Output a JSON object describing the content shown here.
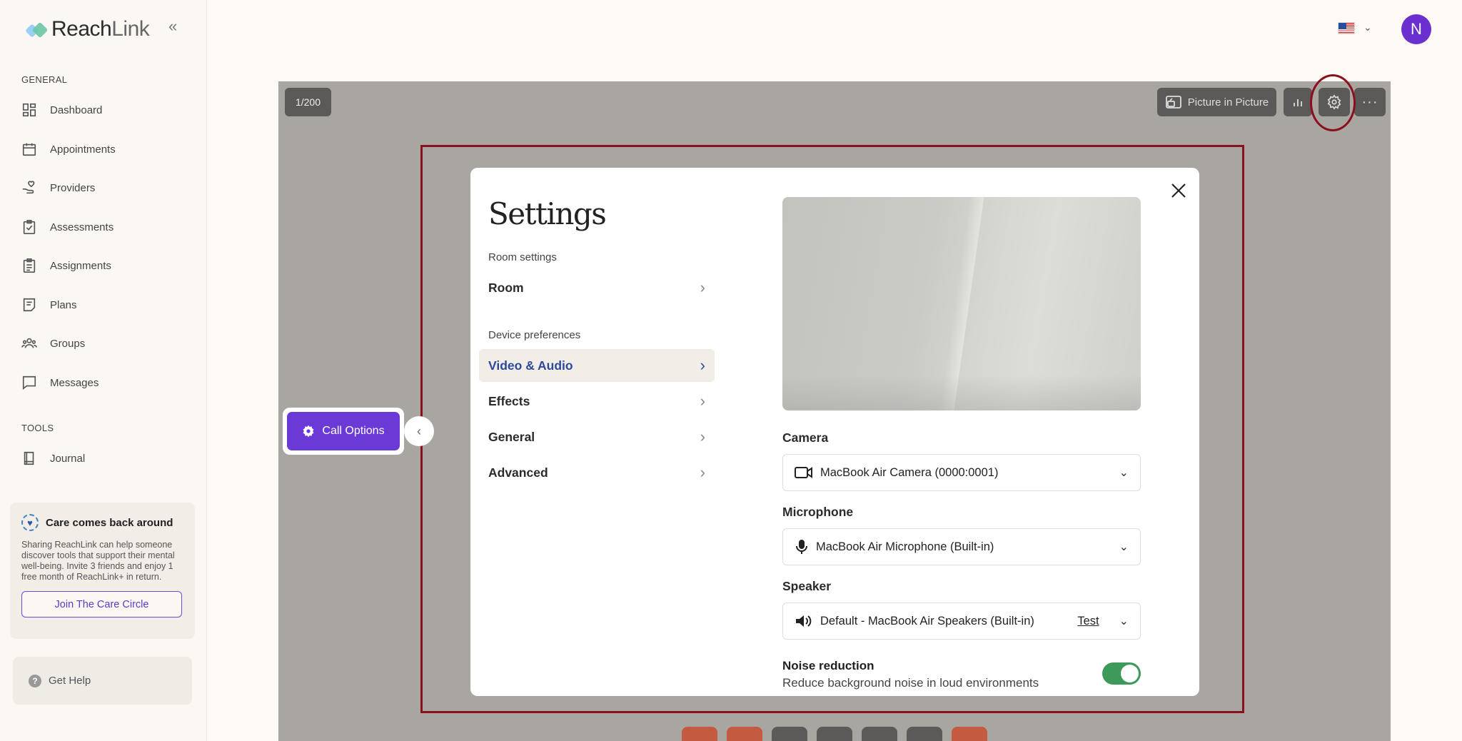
{
  "brand": {
    "name_main": "Reach",
    "name_thin": "Link"
  },
  "sidebar": {
    "general_label": "GENERAL",
    "items": [
      {
        "label": "Dashboard",
        "icon": "dashboard-icon"
      },
      {
        "label": "Appointments",
        "icon": "calendar-icon"
      },
      {
        "label": "Providers",
        "icon": "provider-hand-icon"
      },
      {
        "label": "Assessments",
        "icon": "clipboard-check-icon"
      },
      {
        "label": "Assignments",
        "icon": "clipboard-list-icon"
      },
      {
        "label": "Plans",
        "icon": "plan-note-icon"
      },
      {
        "label": "Groups",
        "icon": "groups-icon"
      },
      {
        "label": "Messages",
        "icon": "message-icon"
      }
    ],
    "tools_label": "TOOLS",
    "tools": [
      {
        "label": "Journal",
        "icon": "journal-icon"
      }
    ],
    "care": {
      "title": "Care comes back around",
      "body": "Sharing ReachLink can help someone discover tools that support their mental well-being. Invite 3 friends and enjoy 1 free month of ReachLink+ in return.",
      "button": "Join The Care Circle"
    },
    "help": "Get Help"
  },
  "header": {
    "avatar_initial": "N",
    "language": "US flag"
  },
  "video": {
    "counter": "1/200",
    "pip_label": "Picture in Picture",
    "call_options": "Call Options"
  },
  "settings": {
    "title": "Settings",
    "room_section": "Room settings",
    "room_item": "Room",
    "device_section": "Device preferences",
    "device_items": [
      "Video & Audio",
      "Effects",
      "General",
      "Advanced"
    ],
    "active_item": "Video & Audio",
    "camera_label": "Camera",
    "camera_value": "MacBook Air Camera (0000:0001)",
    "microphone_label": "Microphone",
    "microphone_value": "MacBook Air Microphone (Built-in)",
    "speaker_label": "Speaker",
    "speaker_value": "Default - MacBook Air Speakers (Built-in)",
    "speaker_test": "Test",
    "noise_title": "Noise reduction",
    "noise_desc": "Reduce background noise in loud environments",
    "noise_enabled": true
  },
  "colors": {
    "accent": "#6b3ad6",
    "highlight_frame": "#8b0f1d",
    "toggle_on": "#3d9a5a",
    "active_nav_text": "#2b4a9b"
  }
}
